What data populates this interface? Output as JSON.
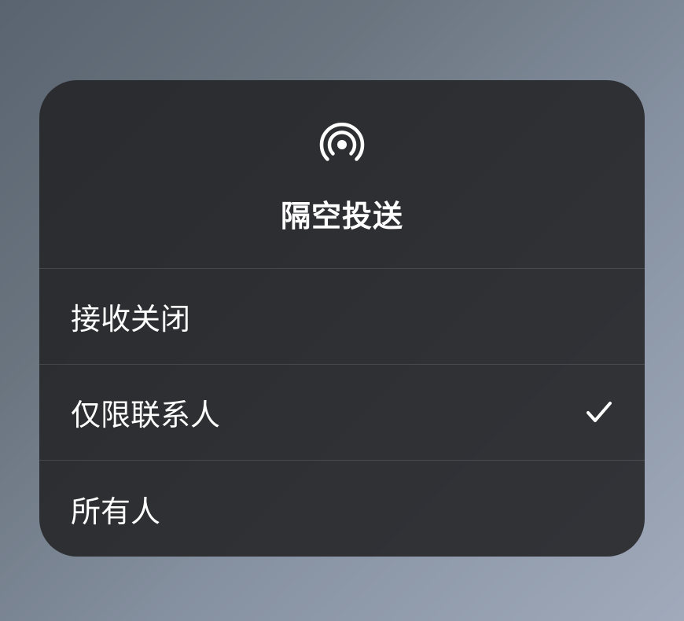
{
  "title": "隔空投送",
  "options": [
    {
      "label": "接收关闭",
      "selected": false
    },
    {
      "label": "仅限联系人",
      "selected": true
    },
    {
      "label": "所有人",
      "selected": false
    }
  ]
}
